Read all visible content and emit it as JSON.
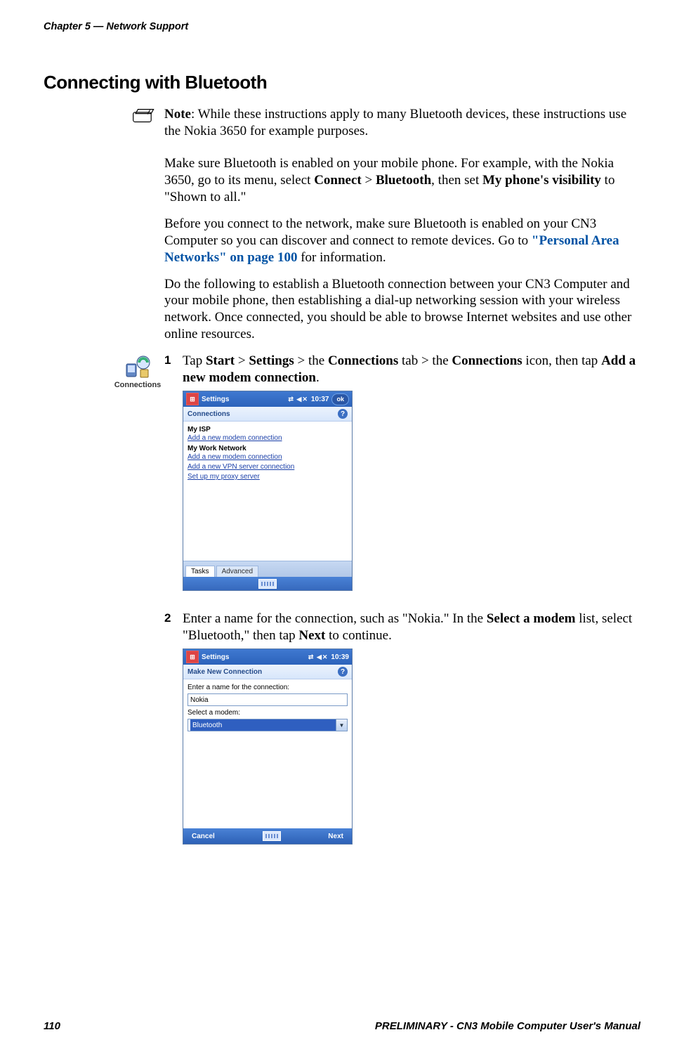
{
  "header": {
    "chapter": "Chapter 5 — Network Support"
  },
  "section": {
    "title": "Connecting with Bluetooth"
  },
  "note": {
    "label": "Note",
    "body_a": ": While these instructions apply to many Bluetooth devices, these instructions use the Nokia 3650 for example purposes."
  },
  "para1": {
    "a": "Make sure Bluetooth is enabled on your mobile phone. For example, with the Nokia 3650, go to its menu, select ",
    "b1": "Connect",
    "gt1": " > ",
    "b2": "Bluetooth",
    "c": ", then set ",
    "b3": "My phone's visibility",
    "d": " to \"Shown to all.\""
  },
  "para2": {
    "a": "Before you connect to the network, make sure Bluetooth is enabled on your CN3 Computer so you can discover and connect to remote devices. Go to ",
    "link": "\"Personal Area Networks\" on page 100",
    "b": " for information."
  },
  "para3": "Do the following to establish a Bluetooth connection between your CN3 Computer and your mobile phone, then establishing a dial-up networking session with your wireless network. Once connected, you should be able to browse Internet websites and use other online resources.",
  "step1": {
    "num": "1",
    "a": "Tap ",
    "b1": "Start",
    "gt1": " > ",
    "b2": "Settings",
    "gt2": " > the ",
    "b3": "Connections",
    "c": " tab > the ",
    "b4": "Connections",
    "d": " icon, then tap ",
    "b5": "Add a new modem connection",
    "e": "."
  },
  "connIcon": {
    "caption": "Connections"
  },
  "shot1": {
    "title": "Settings",
    "clock": "10:37",
    "ok": "ok",
    "sub": "Connections",
    "grp1": "My ISP",
    "l1": "Add a new modem connection",
    "grp2": "My Work Network",
    "l2": "Add a new modem connection",
    "l3": "Add a new VPN server connection",
    "l4": "Set up my proxy server",
    "tab_tasks": "Tasks",
    "tab_adv": "Advanced"
  },
  "step2": {
    "num": "2",
    "a": "Enter a name for the connection, such as \"Nokia.\" In the ",
    "b1": "Select a modem",
    "c": " list, select \"Bluetooth,\" then tap ",
    "b2": "Next",
    "d": " to continue."
  },
  "shot2": {
    "title": "Settings",
    "clock": "10:39",
    "sub": "Make New Connection",
    "lbl_name": "Enter a name for the connection:",
    "val_name": "Nokia",
    "lbl_modem": "Select a modem:",
    "val_modem": "Bluetooth",
    "soft_left": "Cancel",
    "soft_right": "Next"
  },
  "footer": {
    "pagenum": "110",
    "doc": "PRELIMINARY - CN3 Mobile Computer User's Manual"
  }
}
